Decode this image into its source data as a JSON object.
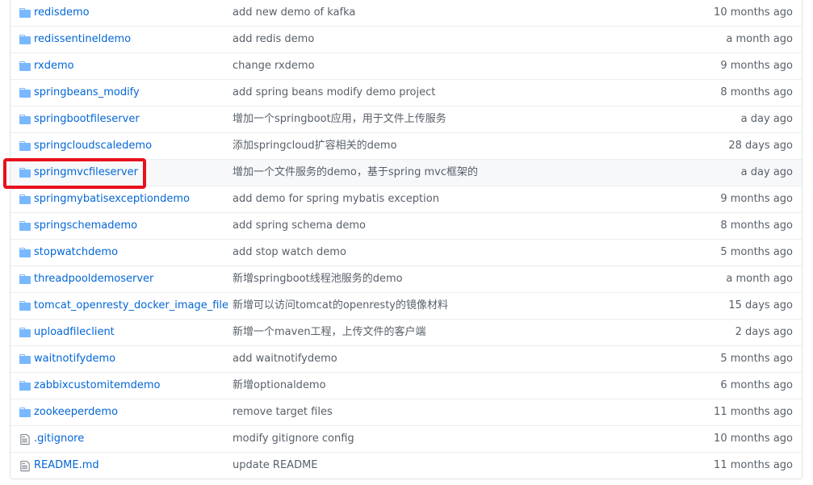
{
  "colors": {
    "link": "#0366d6",
    "muted": "#586069",
    "folder_icon": "#79b8ff",
    "file_icon": "#6a737d",
    "highlight_box": "#e8101d"
  },
  "rows": [
    {
      "type": "dir",
      "icon": "folder-icon",
      "name": "redisdemo",
      "message": "add new demo of kafka",
      "age": "10 months ago"
    },
    {
      "type": "dir",
      "icon": "folder-icon",
      "name": "redissentineldemo",
      "message": "add redis demo",
      "age": "a month ago"
    },
    {
      "type": "dir",
      "icon": "folder-icon",
      "name": "rxdemo",
      "message": "change rxdemo",
      "age": "9 months ago"
    },
    {
      "type": "dir",
      "icon": "folder-icon",
      "name": "springbeans_modify",
      "message": "add spring beans modify demo project",
      "age": "8 months ago"
    },
    {
      "type": "dir",
      "icon": "folder-icon",
      "name": "springbootfileserver",
      "message": "增加一个springboot应用，用于文件上传服务",
      "age": "a day ago"
    },
    {
      "type": "dir",
      "icon": "folder-icon",
      "name": "springcloudscaledemo",
      "message": "添加springcloud扩容相关的demo",
      "age": "28 days ago"
    },
    {
      "type": "dir",
      "icon": "folder-icon",
      "name": "springmvcfileserver",
      "message": "增加一个文件服务的demo，基于spring mvc框架的",
      "age": "a day ago",
      "highlighted": true
    },
    {
      "type": "dir",
      "icon": "folder-icon",
      "name": "springmybatisexceptiondemo",
      "message": "add demo for spring mybatis exception",
      "age": "9 months ago"
    },
    {
      "type": "dir",
      "icon": "folder-icon",
      "name": "springschemademo",
      "message": "add spring schema demo",
      "age": "8 months ago"
    },
    {
      "type": "dir",
      "icon": "folder-icon",
      "name": "stopwatchdemo",
      "message": "add stop watch demo",
      "age": "5 months ago"
    },
    {
      "type": "dir",
      "icon": "folder-icon",
      "name": "threadpooldemoserver",
      "message": "新增springboot线程池服务的demo",
      "age": "a month ago"
    },
    {
      "type": "dir",
      "icon": "folder-icon",
      "name": "tomcat_openresty_docker_image_files",
      "message": "新增可以访问tomcat的openresty的镜像材料",
      "age": "15 days ago"
    },
    {
      "type": "dir",
      "icon": "folder-icon",
      "name": "uploadfileclient",
      "message": "新增一个maven工程，上传文件的客户端",
      "age": "2 days ago"
    },
    {
      "type": "dir",
      "icon": "folder-icon",
      "name": "waitnotifydemo",
      "message": "add waitnotifydemo",
      "age": "5 months ago"
    },
    {
      "type": "dir",
      "icon": "folder-icon",
      "name": "zabbixcustomitemdemo",
      "message": "新增optionaldemo",
      "age": "6 months ago"
    },
    {
      "type": "dir",
      "icon": "folder-icon",
      "name": "zookeeperdemo",
      "message": "remove target files",
      "age": "11 months ago"
    },
    {
      "type": "file",
      "icon": "file-icon",
      "name": ".gitignore",
      "message": "modify gitignore config",
      "age": "10 months ago"
    },
    {
      "type": "file",
      "icon": "file-icon",
      "name": "README.md",
      "message": "update README",
      "age": "11 months ago"
    }
  ]
}
